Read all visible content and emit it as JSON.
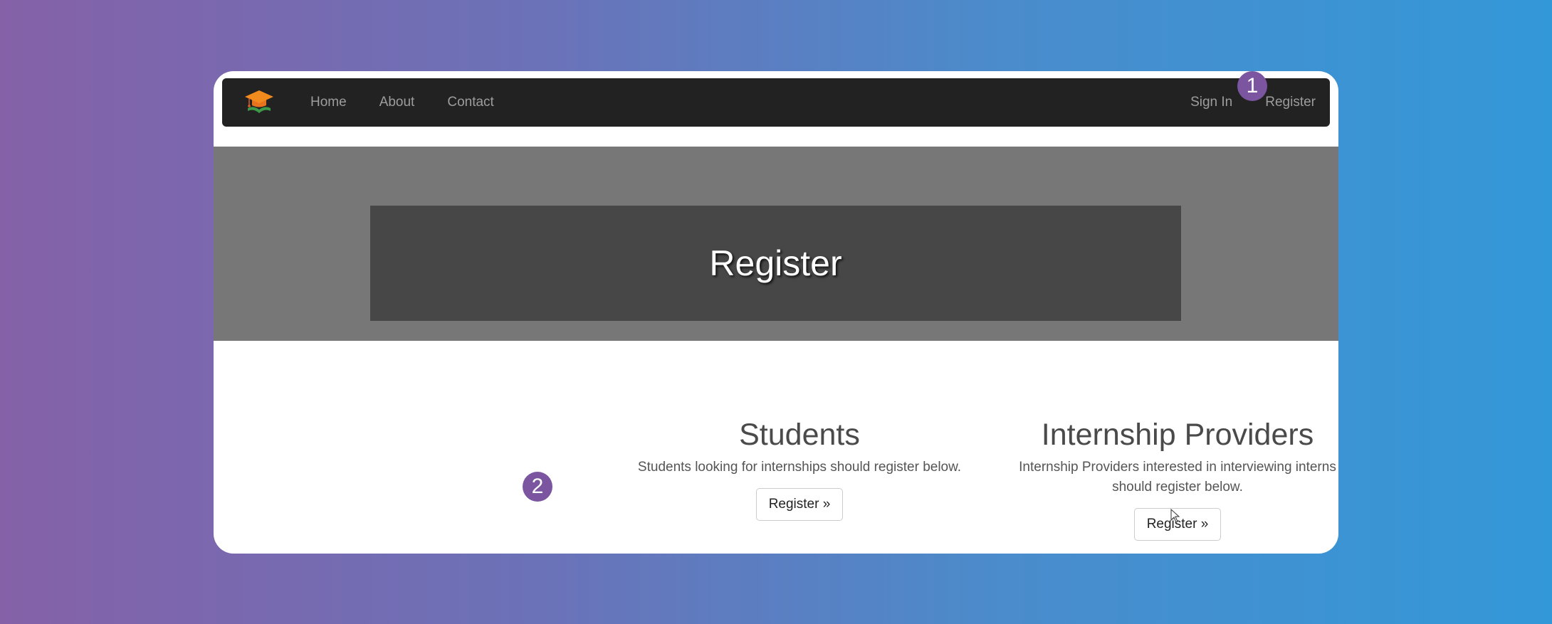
{
  "nav": {
    "brand_icon": "graduation-cap-book-logo",
    "links": [
      "Home",
      "About",
      "Contact"
    ],
    "sign_in": "Sign In",
    "register": "Register"
  },
  "hero": {
    "title": "Register"
  },
  "students": {
    "heading": "Students",
    "text": "Students looking for internships should register below.",
    "button": "Register »"
  },
  "providers": {
    "heading": "Internship Providers",
    "text": "Internship Providers interested in interviewing interns should register below.",
    "button": "Register »"
  },
  "annotations": {
    "badge_1": "1",
    "badge_2": "2"
  },
  "colors": {
    "navbar": "#222222",
    "hero": "#777777",
    "hero_box": "#474747",
    "badge": "#7b55a0"
  }
}
